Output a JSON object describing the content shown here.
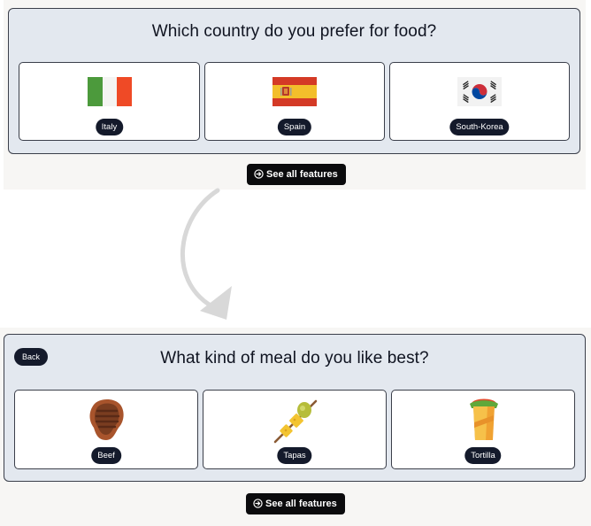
{
  "step1": {
    "question": "Which country do you prefer for food?",
    "options": [
      {
        "label": "Italy",
        "icon": "italy-flag-icon"
      },
      {
        "label": "Spain",
        "icon": "spain-flag-icon"
      },
      {
        "label": "South-Korea",
        "icon": "south-korea-flag-icon"
      }
    ],
    "features_button": "See all features"
  },
  "step2": {
    "back_label": "Back",
    "question": "What kind of meal do you like best?",
    "options": [
      {
        "label": "Beef",
        "icon": "steak-icon"
      },
      {
        "label": "Tapas",
        "icon": "skewer-icon"
      },
      {
        "label": "Tortilla",
        "icon": "burrito-icon"
      }
    ],
    "features_button": "See all features"
  },
  "colors": {
    "panel_bg": "#e3e8ef",
    "pill_bg": "#141a2b",
    "button_bg": "#0b0b0d",
    "arrow": "#d8d8d8"
  }
}
